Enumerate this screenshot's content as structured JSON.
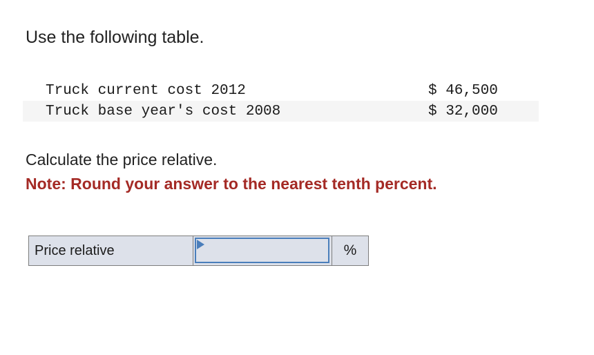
{
  "prompt": {
    "intro": "Use the following table.",
    "calculate": "Calculate the price relative.",
    "note": "Note: Round your answer to the nearest tenth percent."
  },
  "table": {
    "rows": [
      {
        "label": "Truck current cost 2012",
        "value": "$ 46,500"
      },
      {
        "label": "Truck base year's cost 2008",
        "value": "$ 32,000"
      }
    ]
  },
  "answer": {
    "label": "Price relative",
    "value": "",
    "placeholder": "",
    "unit": "%"
  },
  "colors": {
    "note_red": "#a42a25",
    "panel_bg": "#dde1ea",
    "input_border": "#4a7ebb",
    "stripe": "#f5f5f5",
    "cell_border": "#7d7d7d"
  }
}
